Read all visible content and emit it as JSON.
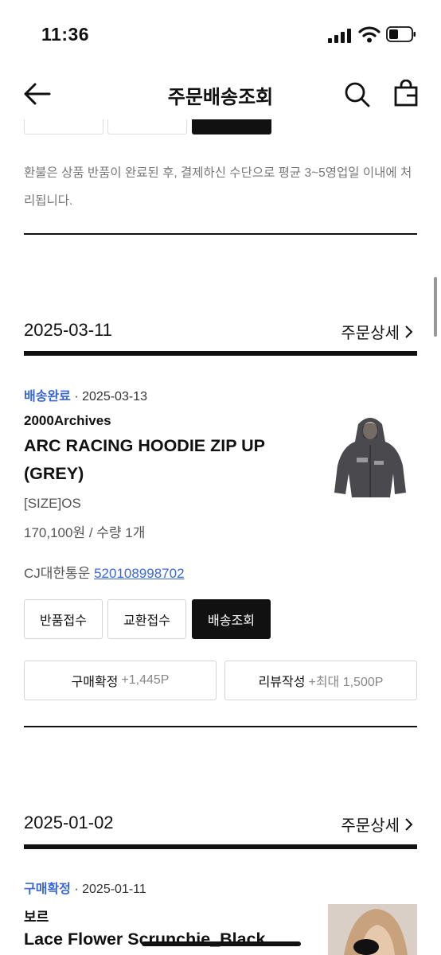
{
  "status_bar": {
    "time": "11:36"
  },
  "header": {
    "title": "주문배송조회"
  },
  "notice": "환불은 상품 반품이 완료된 후, 결제하신 수단으로 평균 3~5영업일 이내에 처리됩니다.",
  "orders": [
    {
      "date": "2025-03-11",
      "detail_label": "주문상세",
      "status": "배송완료",
      "status_sep": "·",
      "status_date": "2025-03-13",
      "brand": "2000Archives",
      "product_name": "ARC RACING HOODIE ZIP UP (GREY)",
      "option": "[SIZE]OS",
      "price_qty": "170,100원 / 수량 1개",
      "courier": "CJ대한통운",
      "tracking": "520108998702",
      "buttons": [
        "반품접수",
        "교환접수",
        "배송조회"
      ],
      "confirm_label": "구매확정",
      "confirm_points": "+1,445P",
      "review_label": "리뷰작성",
      "review_points": "+최대 1,500P"
    },
    {
      "date": "2025-01-02",
      "detail_label": "주문상세",
      "status": "구매확정",
      "status_sep": "·",
      "status_date": "2025-01-11",
      "brand": "보르",
      "product_name": "Lace Flower Scrunchie_Black"
    }
  ]
}
